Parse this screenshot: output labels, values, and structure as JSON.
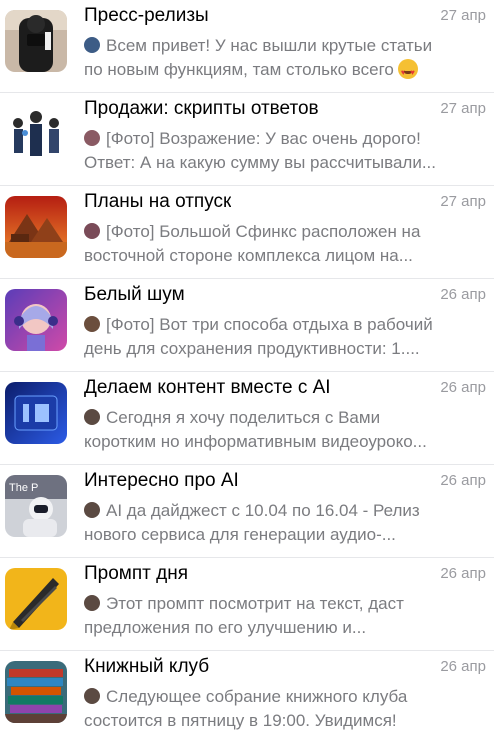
{
  "chats": [
    {
      "title": "Пресс-релизы",
      "date": "27 апр",
      "line1": "Всем привет! У нас вышли крутые статьи",
      "line2": "по новым функциям, там столько всего",
      "mini_color": "#3d5c86",
      "emoji": "heart-eyes"
    },
    {
      "title": "Продажи: скрипты ответов",
      "date": "27 апр",
      "line1": "[Фото] Возражение: У вас очень дорого!",
      "line2": "Ответ: А на какую сумму вы рассчитывали...",
      "mini_color": "#8a5a63"
    },
    {
      "title": "Планы на отпуск",
      "date": "27 апр",
      "line1": "[Фото] Большой Сфинкс расположен на",
      "line2": "восточной стороне комплекса лицом на...",
      "mini_color": "#7a4b58"
    },
    {
      "title": "Белый шум",
      "date": "26 апр",
      "line1": "[Фото] Вот три способа отдыха в рабочий",
      "line2": "день для сохранения продуктивности: 1....",
      "mini_color": "#6b4e3d"
    },
    {
      "title": "Делаем контент вместе с AI",
      "date": "26 апр",
      "line1": "Сегодня я хочу поделиться с Вами",
      "line2": "коротким но информативным видеоуроко...",
      "mini_color": "#5b4a42"
    },
    {
      "title": "Интересно про AI",
      "date": "26 апр",
      "line1": "AI да дайджест с 10.04 по 16.04 - Релиз",
      "line2": "нового сервиса для генерации аудио-...",
      "mini_color": "#5b4a42"
    },
    {
      "title": "Промпт дня",
      "date": "26 апр",
      "line1": "Этот промпт посмотрит на текст, даст",
      "line2": "предложения по его улучшению и...",
      "mini_color": "#5b4a42"
    },
    {
      "title": "Книжный клуб",
      "date": "26 апр",
      "line1": "Следующее собрание книжного клуба",
      "line2": "состоится в пятницу в 19:00. Увидимся!",
      "mini_color": "#5b4a42"
    }
  ],
  "avatar_text": {
    "chat6": "The P"
  }
}
